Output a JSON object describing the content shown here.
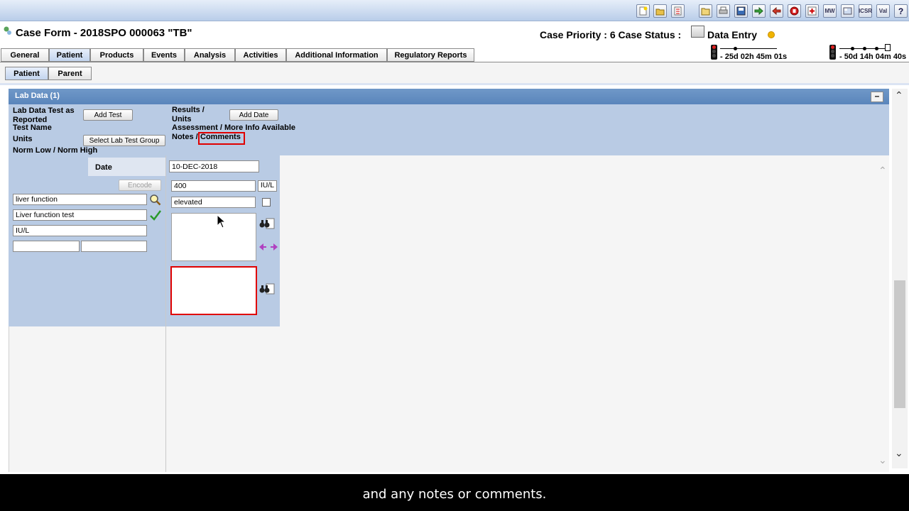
{
  "header": {
    "form_title": "Case Form - 2018SPO 000063 \"TB\"",
    "case_priority_label": "Case Priority : 6 Case Status :",
    "case_status": "Data Entry",
    "timer1": "- 25d 02h 45m 01s",
    "timer2": "- 50d 14h 04m 40s"
  },
  "toolbar": {
    "icons": [
      "new-case-icon",
      "open-case-icon",
      "worklist-icon",
      "open-folder-icon",
      "print-icon",
      "save-icon",
      "forward-icon",
      "return-icon",
      "close-icon",
      "add-case-icon",
      "medwatch-icon",
      "layout-icon",
      "icsr-icon",
      "validate-icon",
      "help-icon"
    ],
    "labels": {
      "medwatch": "MW",
      "icsr": "ICSR",
      "validate": "Val"
    }
  },
  "tabs": [
    "General",
    "Patient",
    "Products",
    "Events",
    "Analysis",
    "Activities",
    "Additional Information",
    "Regulatory Reports"
  ],
  "active_tab": "Patient",
  "subtabs": [
    "Patient",
    "Parent"
  ],
  "section": {
    "title": "Lab Data (1)",
    "collapse": "–"
  },
  "labels": {
    "lab_test_as_reported": "Lab Data Test as Reported",
    "test_name": "Test Name",
    "units": "Units",
    "norm_low_high": "Norm Low / Norm High",
    "results": "Results /",
    "units2": "Units",
    "assessment": "Assessment / More Info Available",
    "notes": "Notes /",
    "comments": "Comments",
    "date": "Date"
  },
  "buttons": {
    "add_test": "Add Test",
    "select_lab_test_group": "Select Lab Test Group",
    "add_date": "Add Date",
    "encode": "Encode"
  },
  "fields": {
    "date": "10-DEC-2018",
    "lab_test_as_reported": "liver function",
    "test_name": "Liver function test",
    "units": "IU/L",
    "norm_low": "",
    "norm_high": "",
    "result": "400",
    "result_units": "IU/L",
    "assessment": "elevated",
    "more_info_checked": false,
    "notes": "",
    "comments": ""
  },
  "caption": "and any notes or comments.",
  "colors": {
    "section_header": "#5a85bb",
    "panel": "#b9cbe4",
    "highlight": "#e00000",
    "status_dot": "#f0b400"
  }
}
